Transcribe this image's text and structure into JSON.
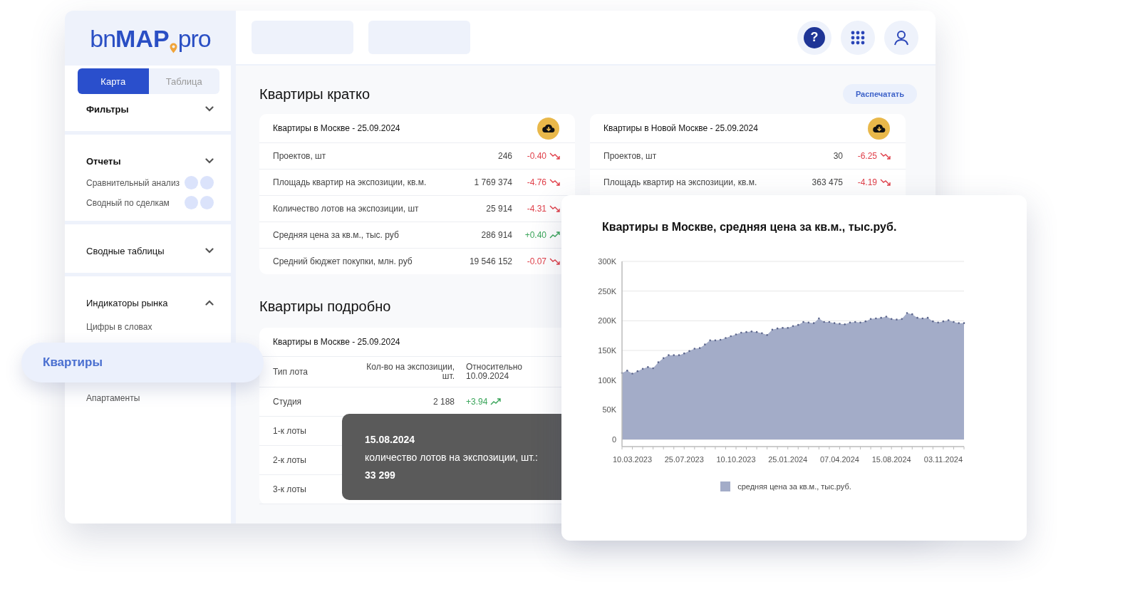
{
  "logo": {
    "light": "bn",
    "bold": "MAP",
    "suffix": "pro"
  },
  "header_buttons": [
    {
      "kind": "help",
      "label": "?"
    },
    {
      "kind": "apps"
    },
    {
      "kind": "user"
    }
  ],
  "view_tabs": [
    {
      "label": "Карта",
      "selected": true
    },
    {
      "label": "Таблица",
      "selected": false
    }
  ],
  "sidebar": {
    "sections": [
      {
        "title": "Фильтры",
        "expanded": false,
        "strong": true
      },
      {
        "title": "Отчеты",
        "expanded": false,
        "strong": true,
        "items": [
          {
            "kind": "report",
            "label": "Сравнительный анализ",
            "selected": false
          },
          {
            "kind": "report",
            "label": "Сводный по сделкам",
            "selected": false
          }
        ]
      },
      {
        "title": "Сводные таблицы",
        "expanded": false,
        "strong": false
      },
      {
        "title": "Индикаторы рынка",
        "expanded": true,
        "strong": false,
        "items": [
          {
            "kind": "link",
            "label": "Цифры в словах",
            "selected": false
          },
          {
            "kind": "link",
            "label": "Квартиры",
            "selected": true
          },
          {
            "kind": "link",
            "label": "Апартаменты",
            "selected": false
          }
        ]
      }
    ]
  },
  "summary": {
    "title": "Квартиры кратко",
    "print_button": "Распечатать",
    "cards": [
      {
        "title": "Квартиры в Москве - 25.09.2024",
        "rows": [
          {
            "label": "Проектов, шт",
            "value": "246",
            "change": "-0.40",
            "rising": false
          },
          {
            "label": "Площадь квартир на экспозиции, кв.м.",
            "value": "1 769 374",
            "change": "-4.76",
            "rising": false
          },
          {
            "label": "Количество лотов на экспозиции, шт",
            "value": "25 914",
            "change": "-4.31",
            "rising": false
          },
          {
            "label": "Средняя цена за кв.м., тыс. руб",
            "value": "286 914",
            "change": "+0.40",
            "rising": true
          },
          {
            "label": "Средний бюджет покупки, млн. руб",
            "value": "19 546 152",
            "change": "-0.07",
            "rising": false
          }
        ]
      },
      {
        "title": "Квартиры в Новой Москве - 25.09.2024",
        "rows": [
          {
            "label": "Проектов, шт",
            "value": "30",
            "change": "-6.25",
            "rising": false
          },
          {
            "label": "Площадь квартир на экспозиции, кв.м.",
            "value": "363 475",
            "change": "-4.19",
            "rising": false
          }
        ]
      }
    ]
  },
  "detail": {
    "title": "Квартиры подробно",
    "card": {
      "title": "Квартиры в Москве - 25.09.2024",
      "columns": [
        "Тип лота",
        "Кол-во на экспозиции, шт.",
        "Относительно 10.09.2024"
      ],
      "rows": [
        {
          "type": "Студия",
          "count": "2 188",
          "change": "+3.94",
          "rising": true
        },
        {
          "type": "1-к лоты"
        },
        {
          "type": "2-к лоты"
        },
        {
          "type": "3-к лоты"
        }
      ]
    }
  },
  "chart_card": {
    "title": "Квартиры в Москве, средняя цена за кв.м., тыс.руб.",
    "chart_data": {
      "type": "area",
      "categories": [
        null,
        null,
        "10.03.2023",
        null,
        null,
        null,
        null,
        null,
        null,
        null,
        null,
        null,
        "25.07.2023",
        null,
        null,
        null,
        null,
        null,
        null,
        null,
        null,
        null,
        "10.10.2023",
        null,
        null,
        null,
        null,
        null,
        null,
        null,
        null,
        null,
        "25.01.2024",
        null,
        null,
        null,
        null,
        null,
        null,
        null,
        null,
        null,
        "07.04.2024",
        null,
        null,
        null,
        null,
        null,
        null,
        null,
        null,
        null,
        "15.08.2024",
        null,
        null,
        null,
        null,
        null,
        null,
        null,
        null,
        null,
        "03.11.2024",
        null,
        null,
        null,
        null
      ],
      "series": [
        {
          "name": "средняя цена за кв.м., тыс.руб.",
          "color": "#a3acc8",
          "values": [
            112,
            116,
            111,
            115,
            119,
            122,
            120,
            130,
            137,
            142,
            142,
            142,
            145,
            149,
            153,
            154,
            160,
            167,
            167,
            168,
            171,
            174,
            177,
            180,
            181,
            182,
            181,
            179,
            176,
            185,
            187,
            188,
            188,
            191,
            193,
            198,
            197,
            196,
            204,
            198,
            198,
            196,
            195,
            194,
            197,
            198,
            197,
            199,
            203,
            204,
            205,
            207,
            203,
            202,
            203,
            213,
            211,
            205,
            204,
            205,
            199,
            197,
            199,
            201,
            198,
            196,
            196
          ]
        }
      ],
      "ylim": [
        0,
        300
      ],
      "grid": true,
      "yticks": [
        {
          "value": 0,
          "label": "0"
        },
        {
          "value": 50,
          "label": "50K"
        },
        {
          "value": 100,
          "label": "100K"
        },
        {
          "value": 150,
          "label": "150K"
        },
        {
          "value": 200,
          "label": "200K"
        },
        {
          "value": 250,
          "label": "250K"
        },
        {
          "value": 300,
          "label": "300K"
        }
      ]
    }
  },
  "tooltip": {
    "date": "15.08.2024",
    "label": "количество лотов на экспозиции, шт.:",
    "value": "33 299"
  }
}
